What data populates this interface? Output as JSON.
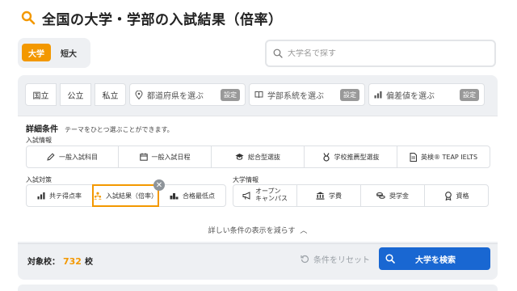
{
  "page": {
    "title": "全国の大学・学部の入試結果（倍率）",
    "accent_color": "#f39800",
    "primary_color": "#1967d2"
  },
  "type_tabs": [
    {
      "label": "大学",
      "active": true
    },
    {
      "label": "短大",
      "active": false
    }
  ],
  "search": {
    "placeholder": "大学名で探す",
    "value": ""
  },
  "filters": {
    "segments": [
      "国立",
      "公立",
      "私立"
    ],
    "pickers": [
      {
        "icon": "map-pin-icon",
        "label": "都道府県を選ぶ",
        "badge": "設定"
      },
      {
        "icon": "book-icon",
        "label": "学部系統を選ぶ",
        "badge": "設定"
      },
      {
        "icon": "bar-chart-icon",
        "label": "偏差値を選ぶ",
        "badge": "設定"
      }
    ]
  },
  "details": {
    "heading": "詳細条件",
    "subheading": "テーマをひとつ選ぶことができます。",
    "exam_info": {
      "label": "入試情報",
      "options": [
        {
          "icon": "pencil-icon",
          "label": "一般入試科目"
        },
        {
          "icon": "calendar-icon",
          "label": "一般入試日程"
        },
        {
          "icon": "graduation-cap-icon",
          "label": "総合型選抜"
        },
        {
          "icon": "medal-icon",
          "label": "学校推薦型選抜"
        },
        {
          "icon": "document-icon",
          "label": "英検® TEAP IELTS"
        }
      ]
    },
    "exam_measures": {
      "label": "入試対策",
      "options": [
        {
          "icon": "bar-chart-icon",
          "label": "共テ得点率",
          "selected": false
        },
        {
          "icon": "people-icon",
          "label": "入試結果（倍率）",
          "selected": true
        },
        {
          "icon": "podium-icon",
          "label": "合格最低点",
          "selected": false
        }
      ]
    },
    "univ_info": {
      "label": "大学情報",
      "options": [
        {
          "icon": "megaphone-icon",
          "label": "オープン キャンパス",
          "line1": "オープン",
          "line2": "キャンパス"
        },
        {
          "icon": "bank-icon",
          "label": "学費"
        },
        {
          "icon": "coins-icon",
          "label": "奨学金"
        },
        {
          "icon": "certificate-icon",
          "label": "資格"
        }
      ]
    },
    "collapse_label": "詳しい条件の表示を減らす"
  },
  "result": {
    "count_label": "対象校：",
    "count_value": "732",
    "count_unit": "校",
    "reset_label": "条件をリセット",
    "search_button_label": "大学を検索"
  }
}
